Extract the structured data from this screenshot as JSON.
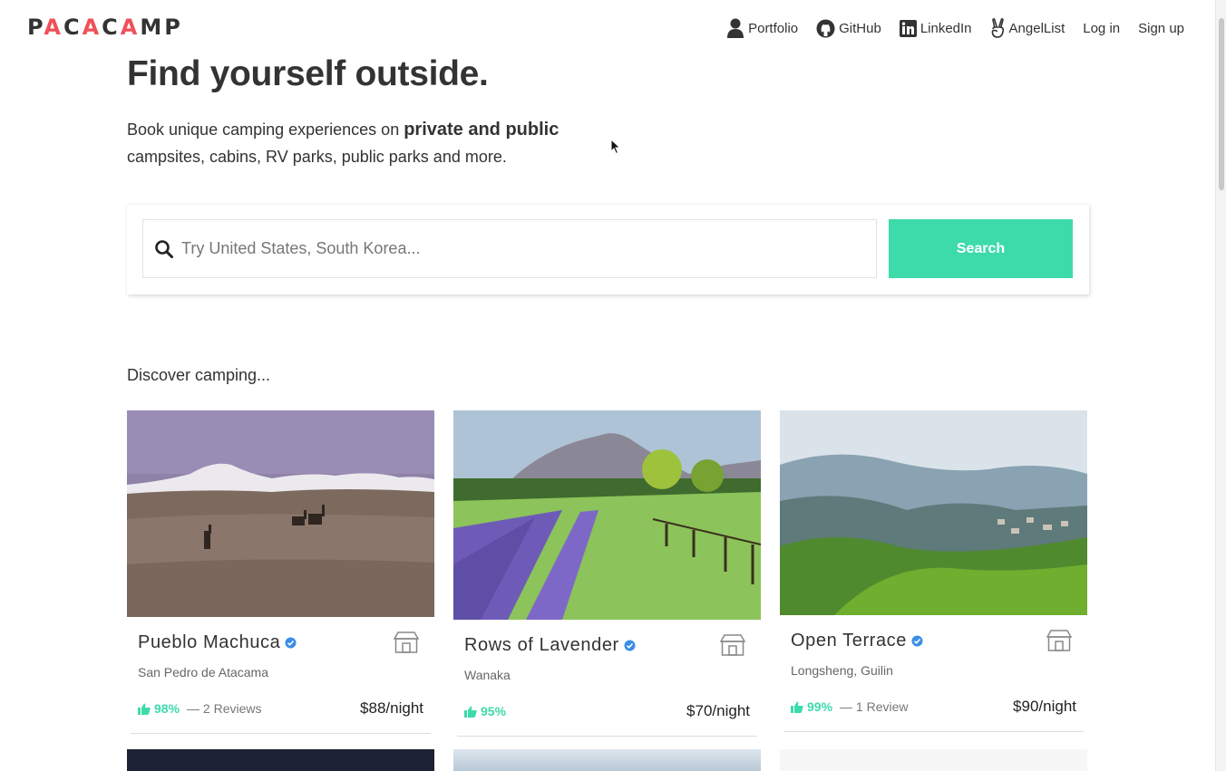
{
  "brand": {
    "logo_text": [
      "P",
      "A",
      "C",
      "A",
      "C",
      "A",
      "M",
      "P"
    ]
  },
  "nav": [
    {
      "label": "Portfolio",
      "icon": "user-icon"
    },
    {
      "label": "GitHub",
      "icon": "github-icon"
    },
    {
      "label": "LinkedIn",
      "icon": "linkedin-icon"
    },
    {
      "label": "AngelList",
      "icon": "angellist-icon"
    },
    {
      "label": "Log in"
    },
    {
      "label": "Sign up"
    }
  ],
  "hero": {
    "title": "Find yourself outside.",
    "sub_pre": "Book unique camping experiences on ",
    "sub_bold": "private and public",
    "sub_post": "campsites, cabins, RV parks, public parks and more."
  },
  "search": {
    "placeholder": "Try United States, South Korea...",
    "value": "",
    "button": "Search"
  },
  "discover": "Discover camping...",
  "cards": [
    {
      "title": "Pueblo Machuca",
      "location": "San Pedro de Atacama",
      "rating": "98%",
      "reviews": "— 2 Reviews",
      "price": "$88/night"
    },
    {
      "title": "Rows of Lavender",
      "location": "Wanaka",
      "rating": "95%",
      "reviews": "",
      "price": "$70/night"
    },
    {
      "title": "Open Terrace",
      "location": "Longsheng, Guilin",
      "rating": "99%",
      "reviews": "— 1 Review",
      "price": "$90/night"
    }
  ],
  "colors": {
    "accent": "#3ddbaa",
    "brand_red": "#f0505a",
    "verified": "#3b8ee8"
  }
}
